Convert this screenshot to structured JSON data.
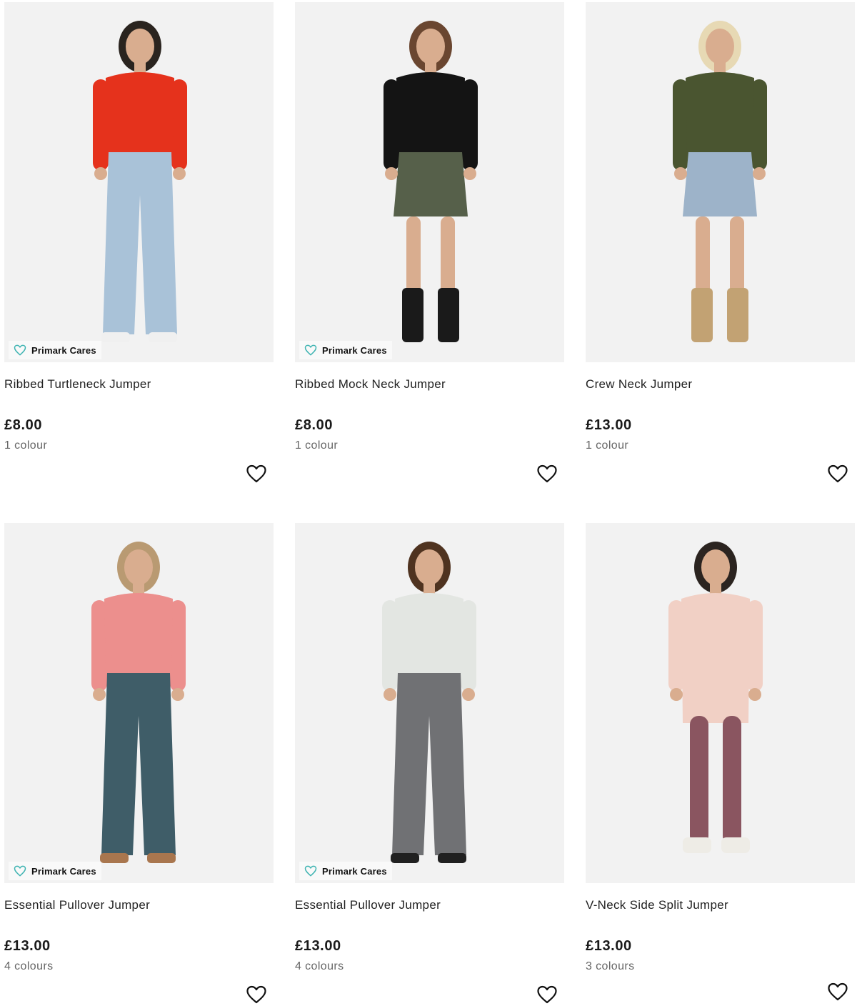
{
  "products": [
    {
      "name": "Ribbed Turtleneck Jumper",
      "price": "£8.00",
      "colours": "1 colour",
      "badge": "Primark Cares",
      "top_colour": "#e5321c",
      "bottom_colour": "#a9c2d8",
      "hair_colour": "#2a241f",
      "shoe_colour": "#f0f0f0"
    },
    {
      "name": "Ribbed Mock Neck Jumper",
      "price": "£8.00",
      "colours": "1 colour",
      "badge": "Primark Cares",
      "top_colour": "#141414",
      "bottom_colour": "#56604a",
      "hair_colour": "#6a4630",
      "shoe_colour": "#1a1a1a"
    },
    {
      "name": "Crew Neck Jumper",
      "price": "£13.00",
      "colours": "1 colour",
      "badge": "",
      "top_colour": "#4a5530",
      "bottom_colour": "#9db3c9",
      "hair_colour": "#e7d9b4",
      "shoe_colour": "#c2a273"
    },
    {
      "name": "Essential Pullover Jumper",
      "price": "£13.00",
      "colours": "4 colours",
      "badge": "Primark Cares",
      "top_colour": "#ec8f8d",
      "bottom_colour": "#3f5d68",
      "hair_colour": "#b99a72",
      "shoe_colour": "#a9764e"
    },
    {
      "name": "Essential Pullover Jumper",
      "price": "£13.00",
      "colours": "4 colours",
      "badge": "Primark Cares",
      "top_colour": "#e3e6e2",
      "bottom_colour": "#707174",
      "hair_colour": "#4f3320",
      "shoe_colour": "#202020"
    },
    {
      "name": "V-Neck Side Split Jumper",
      "price": "£13.00",
      "colours": "3 colours",
      "badge": "",
      "top_colour": "#f1d0c5",
      "bottom_colour": "#8a5560",
      "hair_colour": "#2b2420",
      "shoe_colour": "#eeece6"
    }
  ],
  "colors": {
    "badge_heart": "#3fb4b2",
    "image_bg": "#f2f2f2",
    "skin": "#d9ad8f"
  }
}
